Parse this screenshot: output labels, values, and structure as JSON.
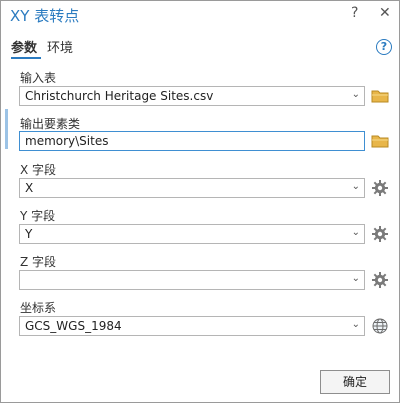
{
  "window": {
    "title": "XY 表转点",
    "help_label": "?",
    "close_label": "✕"
  },
  "tabs": [
    {
      "label": "参数",
      "active": true
    },
    {
      "label": "环境",
      "active": false
    }
  ],
  "help_icon_glyph": "?",
  "params": {
    "input_table": {
      "label": "输入表",
      "value": "Christchurch Heritage Sites.csv",
      "icon": "folder-icon"
    },
    "output_features": {
      "label": "输出要素类",
      "value": "memory\\Sites",
      "icon": "folder-icon"
    },
    "x_field": {
      "label": "X 字段",
      "value": "X",
      "icon": "gear-icon"
    },
    "y_field": {
      "label": "Y 字段",
      "value": "Y",
      "icon": "gear-icon"
    },
    "z_field": {
      "label": "Z 字段",
      "value": "",
      "icon": "gear-icon"
    },
    "coord_system": {
      "label": "坐标系",
      "value": "GCS_WGS_1984",
      "icon": "globe-icon"
    }
  },
  "chevron_glyph": "⌄",
  "ok_label": "确定",
  "colors": {
    "accent": "#2b7bc0",
    "folder": "#e8b64a",
    "marker": "#9cc3e6"
  }
}
